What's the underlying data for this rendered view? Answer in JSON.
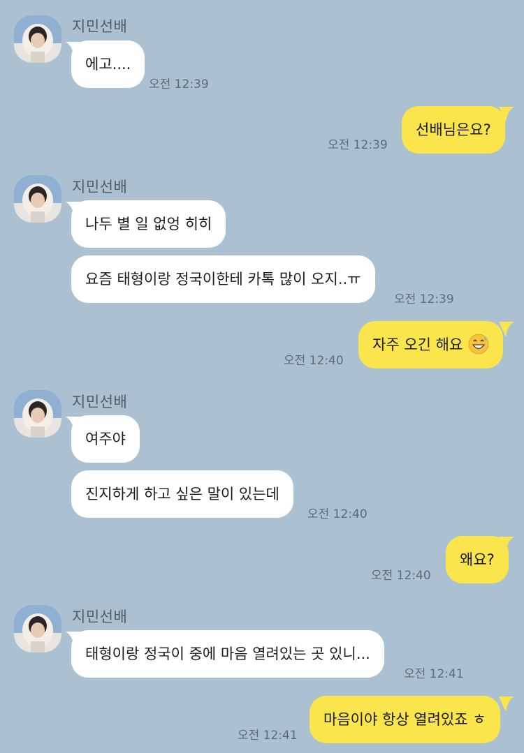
{
  "colors": {
    "background": "#abc0d1",
    "incoming_bubble": "#ffffff",
    "outgoing_bubble": "#fae64c",
    "timestamp": "#5c6b78"
  },
  "messages": [
    {
      "direction": "in",
      "sender": "지민선배",
      "text": "에고....",
      "time": "오전 12:39"
    },
    {
      "direction": "out",
      "text": "선배님은요?",
      "time": "오전 12:39"
    },
    {
      "direction": "in",
      "sender": "지민선배",
      "text": "나두 별 일 없엉 히히"
    },
    {
      "direction": "in",
      "text": "요즘 태형이랑 정국이한테 카톡 많이 오지..ㅠ",
      "time": "오전 12:39"
    },
    {
      "direction": "out",
      "text": "자주 오긴 해요",
      "emoji": "grinning-sweat-emoji",
      "time": "오전 12:40"
    },
    {
      "direction": "in",
      "sender": "지민선배",
      "text": "여주야"
    },
    {
      "direction": "in",
      "text": "진지하게 하고 싶은 말이 있는데",
      "time": "오전 12:40"
    },
    {
      "direction": "out",
      "text": "왜요?",
      "time": "오전 12:40"
    },
    {
      "direction": "in",
      "sender": "지민선배",
      "text": "태형이랑 정국이 중에 마음 열려있는 곳 있니...",
      "time": "오전 12:41"
    },
    {
      "direction": "out",
      "text": "마음이야 항상 열려있죠 ㅎ",
      "time": "오전 12:41"
    }
  ]
}
